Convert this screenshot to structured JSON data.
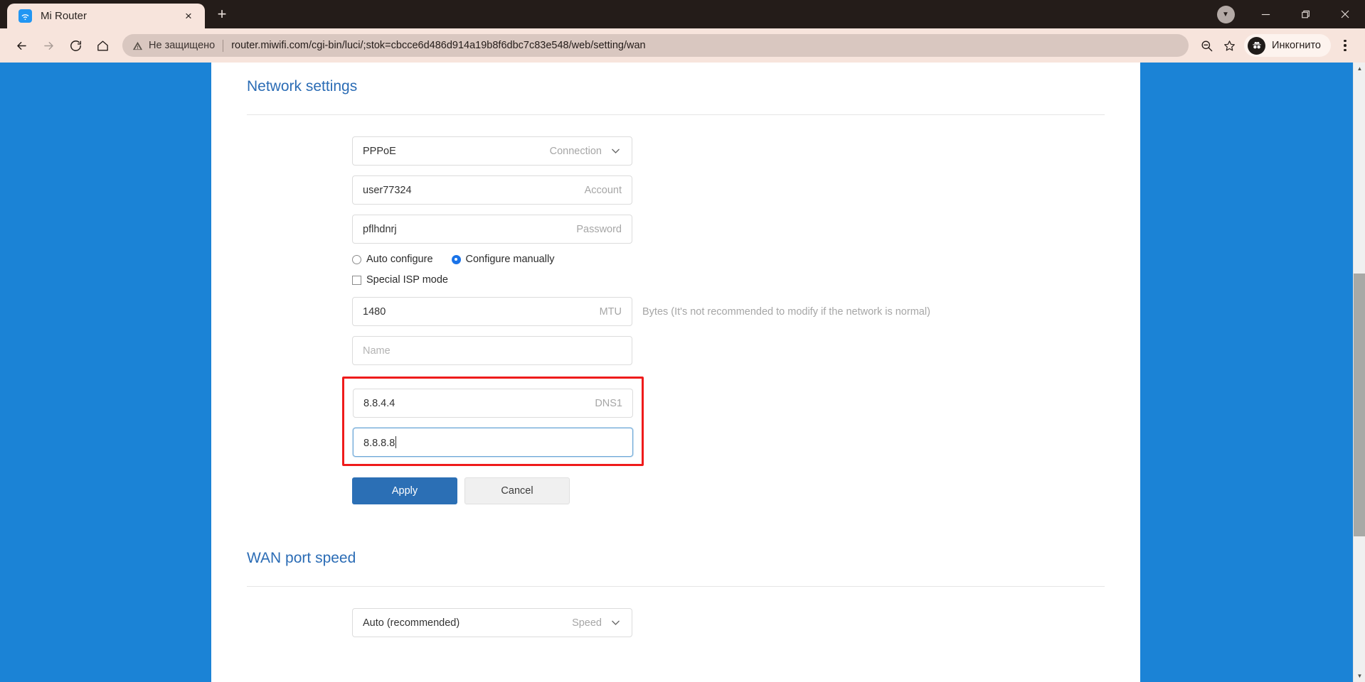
{
  "browser": {
    "tab": {
      "title": "Mi Router",
      "favicon": "wifi-icon",
      "close": "×"
    },
    "new_tab_label": "+",
    "window_controls": {
      "update": "update-icon",
      "minimize": "—",
      "maximize": "restore-icon",
      "close": "✕"
    },
    "toolbar": {
      "back": "back-arrow-icon",
      "forward": "forward-arrow-icon",
      "reload": "reload-icon",
      "home": "home-icon",
      "security_text": "Не защищено",
      "url": "router.miwifi.com/cgi-bin/luci/;stok=cbcce6d486d914a19b8f6dbc7c83e548/web/setting/wan",
      "zoom_out": "zoom-out-icon",
      "bookmark": "star-icon",
      "incognito_label": "Инкогнито",
      "menu": "three-dots-icon"
    }
  },
  "colors": {
    "page_background": "#1b83d6",
    "accent_blue": "#2b6cb5",
    "primary_button": "#2b6fb5",
    "highlight_red": "#ef1b1b",
    "radio_selected": "#1a73e8"
  },
  "page": {
    "network_settings": {
      "title": "Network settings",
      "connection": {
        "value": "PPPoE",
        "label": "Connection"
      },
      "account": {
        "value": "user77324",
        "label": "Account"
      },
      "password": {
        "value": "pflhdnrj",
        "label": "Password"
      },
      "config_mode": {
        "options": [
          {
            "label": "Auto configure",
            "selected": false
          },
          {
            "label": "Configure manually",
            "selected": true
          }
        ]
      },
      "special_isp": {
        "label": "Special ISP mode",
        "checked": false
      },
      "mtu": {
        "value": "1480",
        "label": "MTU",
        "hint": "Bytes (It's not recommended to modify if the network is normal)"
      },
      "name": {
        "value": "",
        "placeholder": "Name"
      },
      "dns1": {
        "value": "8.8.4.4",
        "label": "DNS1"
      },
      "dns2": {
        "value": "8.8.8.8",
        "label": "",
        "focused": true
      },
      "apply_button": "Apply",
      "cancel_button": "Cancel"
    },
    "wan_port_speed": {
      "title": "WAN port speed",
      "speed": {
        "value": "Auto (recommended)",
        "label": "Speed"
      }
    }
  }
}
